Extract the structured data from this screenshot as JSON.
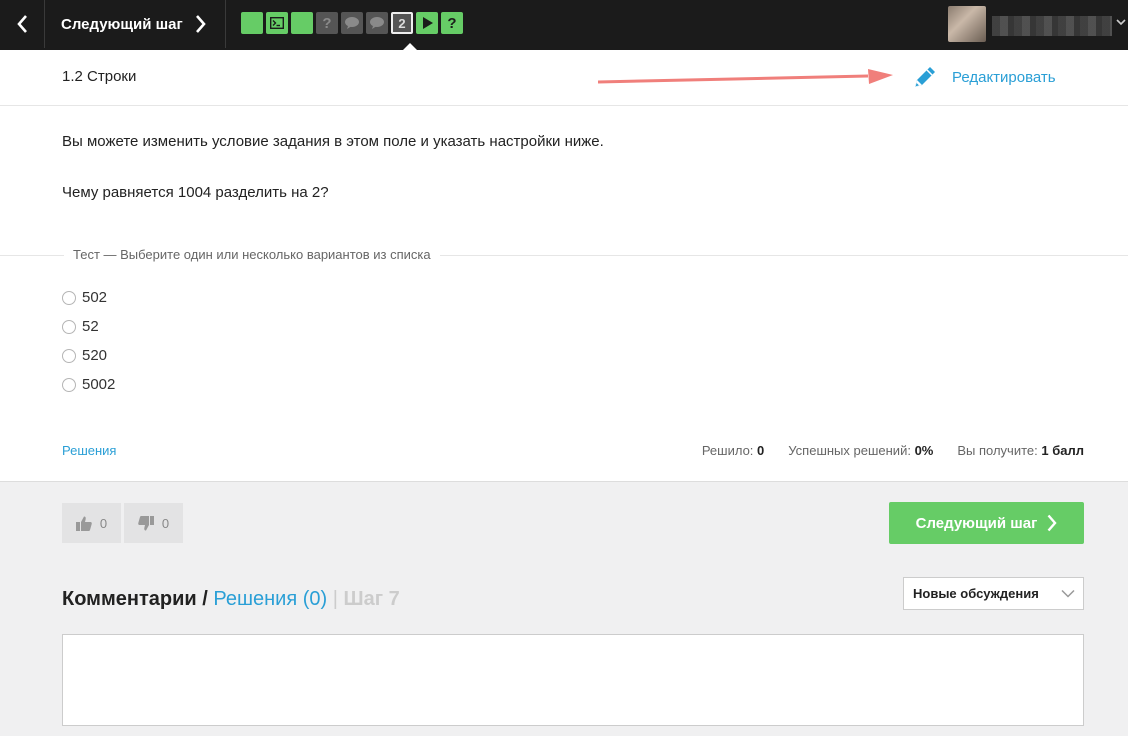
{
  "topbar": {
    "next_step_label": "Следующий шаг",
    "current_step_number": "2",
    "steps": [
      {
        "type": "text",
        "status": "passed"
      },
      {
        "type": "code",
        "status": "passed"
      },
      {
        "type": "text",
        "status": "passed"
      },
      {
        "type": "question",
        "status": "default"
      },
      {
        "type": "discussion",
        "status": "default"
      },
      {
        "type": "discussion",
        "status": "default"
      },
      {
        "type": "number",
        "status": "current"
      },
      {
        "type": "video",
        "status": "passed"
      },
      {
        "type": "question",
        "status": "passed"
      }
    ]
  },
  "lesson": {
    "title": "1.2 Строки",
    "edit_label": "Редактировать"
  },
  "content": {
    "paragraph_1": "Вы можете изменить условие задания в этом поле и указать настройки ниже.",
    "paragraph_2": "Чему равняется 1004 разделить на 2?"
  },
  "quiz": {
    "legend": "Тест — Выберите один или несколько вариантов из списка",
    "options": [
      "502",
      "52",
      "520",
      "5002"
    ]
  },
  "footer": {
    "solutions_link": "Решения",
    "solved_label": "Решило:",
    "solved_value": "0",
    "success_label": "Успешных решений:",
    "success_value": "0%",
    "reward_label": "Вы получите:",
    "reward_value": "1 балл"
  },
  "actions": {
    "likes": "0",
    "dislikes": "0",
    "next_step_label": "Следующий шаг"
  },
  "comments": {
    "heading": "Комментарии",
    "slash": " / ",
    "solutions_tab": "Решения (0)",
    "pipe": " | ",
    "step_label": "Шаг 7",
    "sort_selected": "Новые обсуждения"
  },
  "colors": {
    "accent_blue": "#2a9fd6",
    "success_green": "#66cc66",
    "topbar_bg": "#1b1b1b",
    "annotation_arrow": "#f07f7b"
  }
}
